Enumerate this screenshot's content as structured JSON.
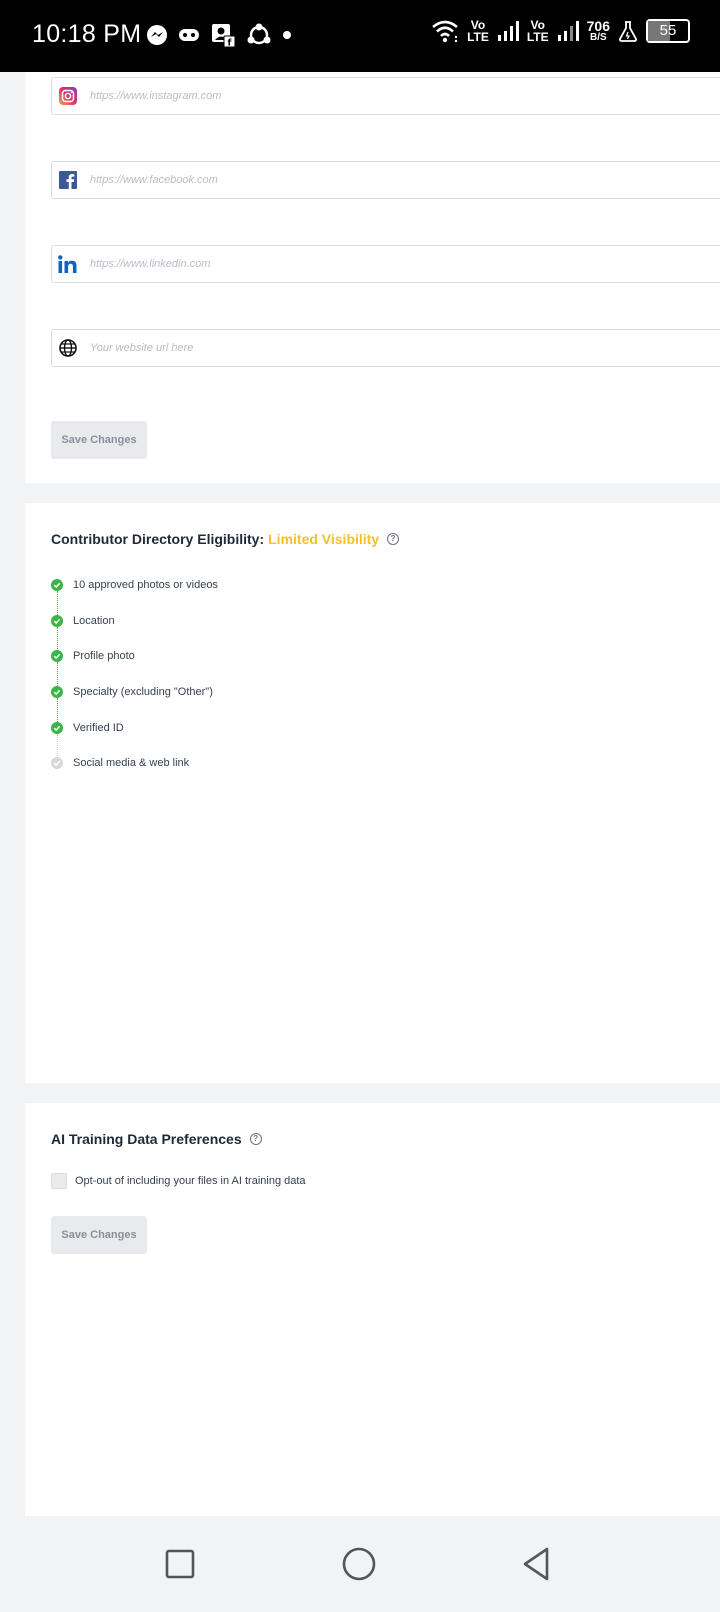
{
  "status_bar": {
    "time": "10:18 PM",
    "left_icons": [
      "messenger-icon",
      "gamepad-icon",
      "contact-facebook-icon",
      "share-icon",
      "dot-icon"
    ],
    "volte1": [
      "Vo",
      "LTE"
    ],
    "volte2": [
      "Vo",
      "LTE"
    ],
    "speed_value": "706",
    "speed_unit": "B/S",
    "battery": "55"
  },
  "social_links": {
    "instagram": {
      "placeholder": "https://www.instagram.com",
      "value": ""
    },
    "facebook": {
      "placeholder": "https://www.facebook.com",
      "value": ""
    },
    "linkedin": {
      "placeholder": "https://www.linkedin.com",
      "value": ""
    },
    "website": {
      "placeholder": "Your website url here",
      "value": ""
    },
    "save_label": "Save Changes"
  },
  "eligibility": {
    "title": "Contributor Directory Eligibility:",
    "status": "Limited Visibility",
    "status_color": "#f3c02b",
    "items": [
      {
        "label": "10 approved photos or videos",
        "done": true
      },
      {
        "label": "Location",
        "done": true
      },
      {
        "label": "Profile photo",
        "done": true
      },
      {
        "label": "Specialty (excluding \"Other\")",
        "done": true
      },
      {
        "label": "Verified ID",
        "done": true
      },
      {
        "label": "Social media & web link",
        "done": false
      }
    ]
  },
  "ai_prefs": {
    "title": "AI Training Data Preferences",
    "optout_label": "Opt-out of including your files in AI training data",
    "optout_checked": false,
    "save_label": "Save Changes"
  },
  "colors": {
    "check_green": "#3bb54a",
    "pending_gray": "#d5d9de"
  }
}
